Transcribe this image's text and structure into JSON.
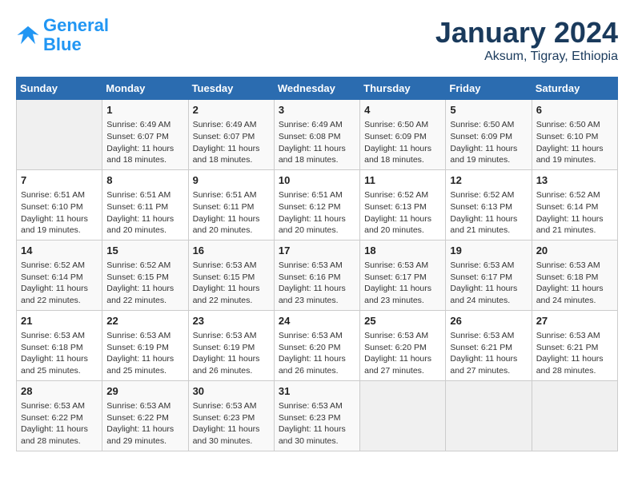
{
  "logo": {
    "line1": "General",
    "line2": "Blue"
  },
  "title": "January 2024",
  "subtitle": "Aksum, Tigray, Ethiopia",
  "weekdays": [
    "Sunday",
    "Monday",
    "Tuesday",
    "Wednesday",
    "Thursday",
    "Friday",
    "Saturday"
  ],
  "weeks": [
    [
      null,
      {
        "day": 1,
        "sunrise": "6:49 AM",
        "sunset": "6:07 PM",
        "daylight": "11 hours and 18 minutes."
      },
      {
        "day": 2,
        "sunrise": "6:49 AM",
        "sunset": "6:07 PM",
        "daylight": "11 hours and 18 minutes."
      },
      {
        "day": 3,
        "sunrise": "6:49 AM",
        "sunset": "6:08 PM",
        "daylight": "11 hours and 18 minutes."
      },
      {
        "day": 4,
        "sunrise": "6:50 AM",
        "sunset": "6:09 PM",
        "daylight": "11 hours and 18 minutes."
      },
      {
        "day": 5,
        "sunrise": "6:50 AM",
        "sunset": "6:09 PM",
        "daylight": "11 hours and 19 minutes."
      },
      {
        "day": 6,
        "sunrise": "6:50 AM",
        "sunset": "6:10 PM",
        "daylight": "11 hours and 19 minutes."
      }
    ],
    [
      {
        "day": 7,
        "sunrise": "6:51 AM",
        "sunset": "6:10 PM",
        "daylight": "11 hours and 19 minutes."
      },
      {
        "day": 8,
        "sunrise": "6:51 AM",
        "sunset": "6:11 PM",
        "daylight": "11 hours and 20 minutes."
      },
      {
        "day": 9,
        "sunrise": "6:51 AM",
        "sunset": "6:11 PM",
        "daylight": "11 hours and 20 minutes."
      },
      {
        "day": 10,
        "sunrise": "6:51 AM",
        "sunset": "6:12 PM",
        "daylight": "11 hours and 20 minutes."
      },
      {
        "day": 11,
        "sunrise": "6:52 AM",
        "sunset": "6:13 PM",
        "daylight": "11 hours and 20 minutes."
      },
      {
        "day": 12,
        "sunrise": "6:52 AM",
        "sunset": "6:13 PM",
        "daylight": "11 hours and 21 minutes."
      },
      {
        "day": 13,
        "sunrise": "6:52 AM",
        "sunset": "6:14 PM",
        "daylight": "11 hours and 21 minutes."
      }
    ],
    [
      {
        "day": 14,
        "sunrise": "6:52 AM",
        "sunset": "6:14 PM",
        "daylight": "11 hours and 22 minutes."
      },
      {
        "day": 15,
        "sunrise": "6:52 AM",
        "sunset": "6:15 PM",
        "daylight": "11 hours and 22 minutes."
      },
      {
        "day": 16,
        "sunrise": "6:53 AM",
        "sunset": "6:15 PM",
        "daylight": "11 hours and 22 minutes."
      },
      {
        "day": 17,
        "sunrise": "6:53 AM",
        "sunset": "6:16 PM",
        "daylight": "11 hours and 23 minutes."
      },
      {
        "day": 18,
        "sunrise": "6:53 AM",
        "sunset": "6:17 PM",
        "daylight": "11 hours and 23 minutes."
      },
      {
        "day": 19,
        "sunrise": "6:53 AM",
        "sunset": "6:17 PM",
        "daylight": "11 hours and 24 minutes."
      },
      {
        "day": 20,
        "sunrise": "6:53 AM",
        "sunset": "6:18 PM",
        "daylight": "11 hours and 24 minutes."
      }
    ],
    [
      {
        "day": 21,
        "sunrise": "6:53 AM",
        "sunset": "6:18 PM",
        "daylight": "11 hours and 25 minutes."
      },
      {
        "day": 22,
        "sunrise": "6:53 AM",
        "sunset": "6:19 PM",
        "daylight": "11 hours and 25 minutes."
      },
      {
        "day": 23,
        "sunrise": "6:53 AM",
        "sunset": "6:19 PM",
        "daylight": "11 hours and 26 minutes."
      },
      {
        "day": 24,
        "sunrise": "6:53 AM",
        "sunset": "6:20 PM",
        "daylight": "11 hours and 26 minutes."
      },
      {
        "day": 25,
        "sunrise": "6:53 AM",
        "sunset": "6:20 PM",
        "daylight": "11 hours and 27 minutes."
      },
      {
        "day": 26,
        "sunrise": "6:53 AM",
        "sunset": "6:21 PM",
        "daylight": "11 hours and 27 minutes."
      },
      {
        "day": 27,
        "sunrise": "6:53 AM",
        "sunset": "6:21 PM",
        "daylight": "11 hours and 28 minutes."
      }
    ],
    [
      {
        "day": 28,
        "sunrise": "6:53 AM",
        "sunset": "6:22 PM",
        "daylight": "11 hours and 28 minutes."
      },
      {
        "day": 29,
        "sunrise": "6:53 AM",
        "sunset": "6:22 PM",
        "daylight": "11 hours and 29 minutes."
      },
      {
        "day": 30,
        "sunrise": "6:53 AM",
        "sunset": "6:23 PM",
        "daylight": "11 hours and 30 minutes."
      },
      {
        "day": 31,
        "sunrise": "6:53 AM",
        "sunset": "6:23 PM",
        "daylight": "11 hours and 30 minutes."
      },
      null,
      null,
      null
    ]
  ]
}
